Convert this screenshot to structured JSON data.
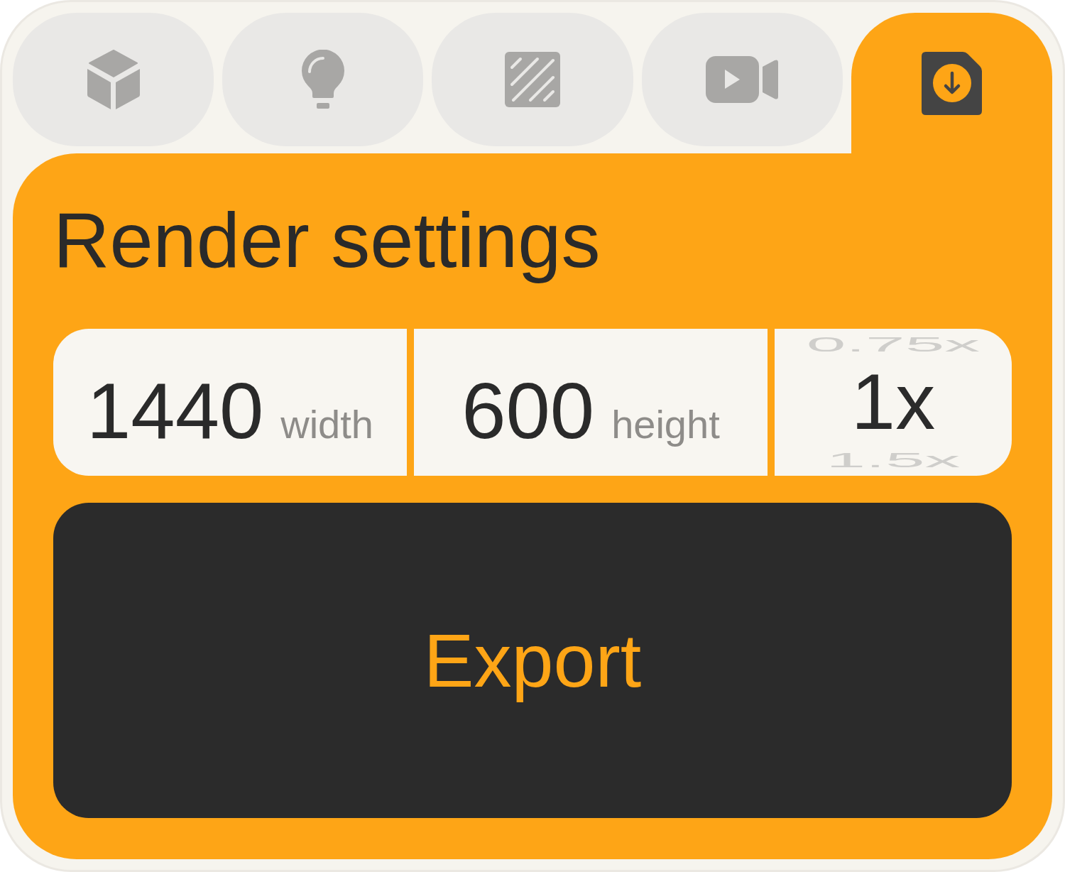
{
  "tabs": [
    {
      "selected": false
    },
    {
      "selected": false
    },
    {
      "selected": false
    },
    {
      "selected": false
    },
    {
      "selected": true
    }
  ],
  "panel": {
    "title": "Render settings",
    "fields": [
      {
        "value": "1440",
        "label": "width"
      },
      {
        "value": "600",
        "label": "height"
      }
    ],
    "scale_picker": {
      "options": [
        {
          "label": "0.75x",
          "selected": false
        },
        {
          "label": "1x",
          "selected": true
        },
        {
          "label": "1.5x",
          "selected": false
        }
      ]
    },
    "export_button": {
      "label": "Export"
    }
  }
}
